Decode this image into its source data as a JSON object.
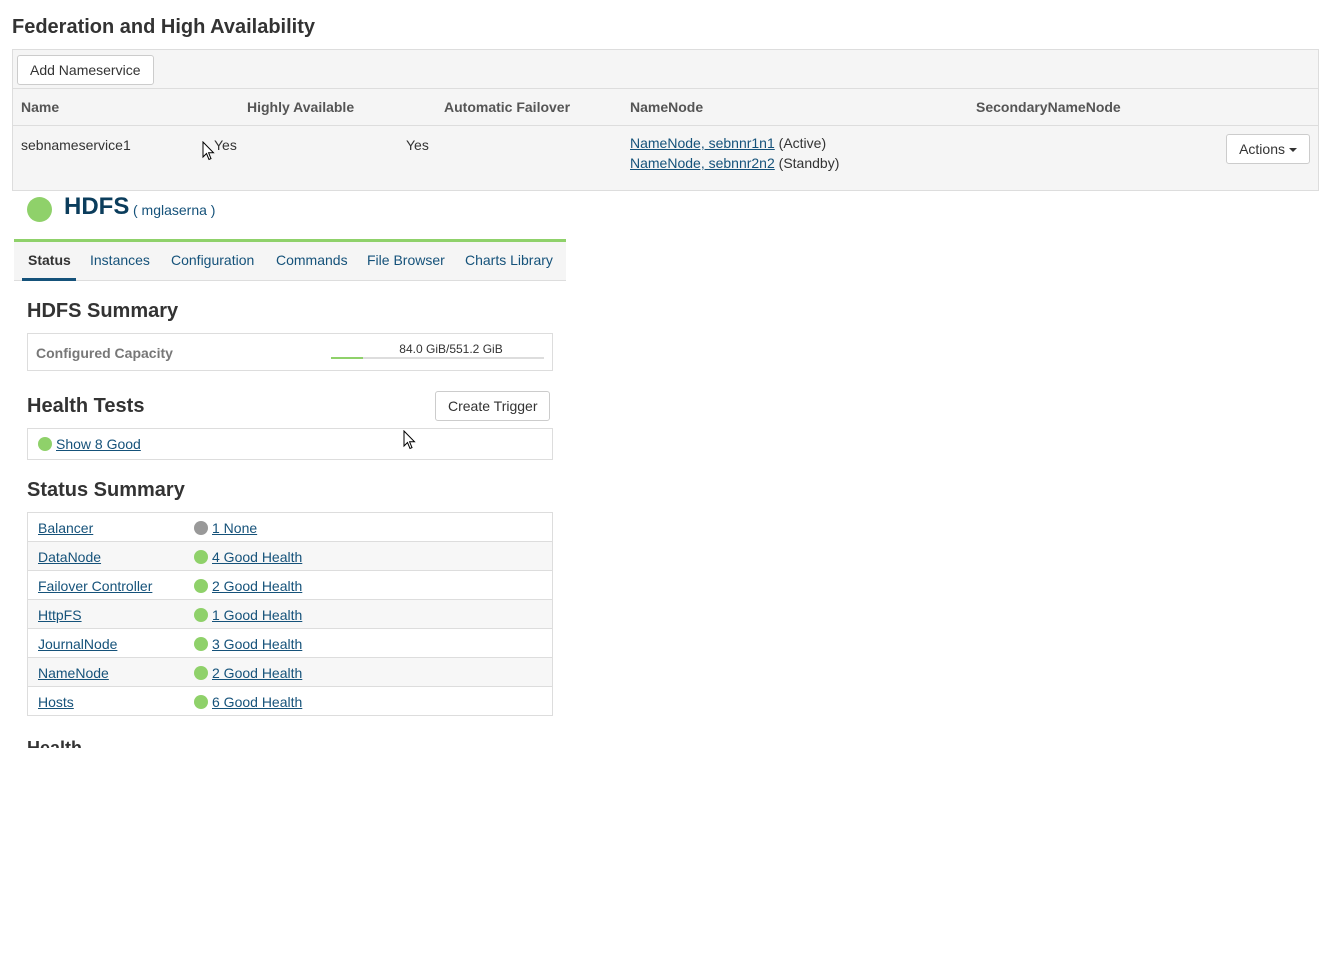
{
  "page": {
    "title": "Federation and High Availability"
  },
  "federation": {
    "add_button": "Add Nameservice",
    "columns": [
      "Name",
      "Highly Available",
      "Automatic Failover",
      "NameNode",
      "SecondaryNameNode"
    ],
    "row": {
      "name": "sebnameservice1",
      "highly_available": "Yes",
      "automatic_failover": "Yes",
      "namenodes": [
        {
          "link": "NameNode, sebnnr1n1",
          "state": "(Active)"
        },
        {
          "link": "NameNode, sebnnr2n2",
          "state": "(Standby)"
        }
      ],
      "secondary_namenode": "",
      "actions_label": "Actions"
    }
  },
  "service": {
    "name": "HDFS",
    "cluster": "( mglaserna )",
    "health_color": "#8fd16a"
  },
  "tabs": [
    "Status",
    "Instances",
    "Configuration",
    "Commands",
    "File Browser",
    "Charts Library"
  ],
  "active_tab": "Status",
  "summary": {
    "title": "HDFS Summary",
    "capacity_label": "Configured Capacity",
    "capacity_value": "84.0 GiB/551.2 GiB",
    "capacity_fraction": 0.152
  },
  "health_tests": {
    "title": "Health Tests",
    "create_trigger": "Create Trigger",
    "show_good": "Show 8 Good"
  },
  "status_summary": {
    "title": "Status Summary",
    "rows": [
      {
        "name": "Balancer",
        "status": "1 None",
        "health": "none"
      },
      {
        "name": "DataNode",
        "status": "4 Good Health",
        "health": "good"
      },
      {
        "name": "Failover Controller",
        "status": "2 Good Health",
        "health": "good"
      },
      {
        "name": "HttpFS",
        "status": "1 Good Health",
        "health": "good"
      },
      {
        "name": "JournalNode",
        "status": "3 Good Health",
        "health": "good"
      },
      {
        "name": "NameNode",
        "status": "2 Good Health",
        "health": "good"
      },
      {
        "name": "Hosts",
        "status": "6 Good Health",
        "health": "good"
      }
    ]
  },
  "next_section_title": "Health History"
}
